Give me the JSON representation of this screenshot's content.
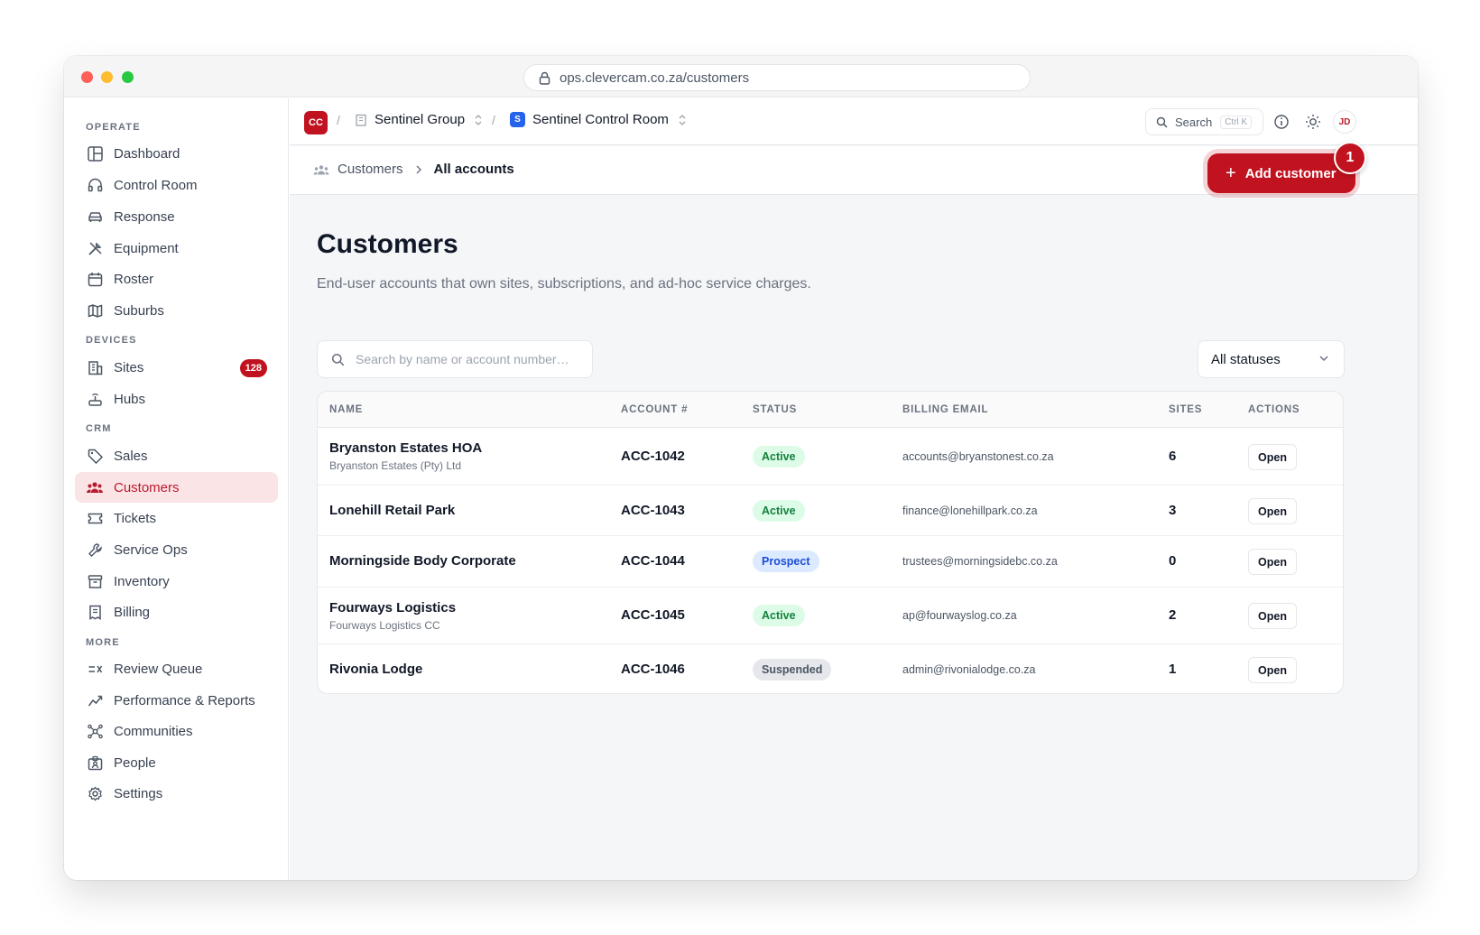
{
  "browser": {
    "url": "ops.clevercam.co.za/customers"
  },
  "sidebar": {
    "sections": {
      "operate": "OPERATE",
      "devices": "DEVICES",
      "crm": "CRM",
      "more": "MORE"
    },
    "operate_items": [
      {
        "label": "Dashboard",
        "icon": "layout-icon"
      },
      {
        "label": "Control Room",
        "icon": "headset-icon"
      },
      {
        "label": "Response",
        "icon": "car-icon"
      },
      {
        "label": "Equipment",
        "icon": "tools-icon"
      },
      {
        "label": "Roster",
        "icon": "calendar-icon"
      },
      {
        "label": "Suburbs",
        "icon": "map-icon"
      }
    ],
    "devices_items": [
      {
        "label": "Sites",
        "icon": "building-icon",
        "badge": "128"
      },
      {
        "label": "Hubs",
        "icon": "router-icon"
      }
    ],
    "crm_items": [
      {
        "label": "Sales",
        "icon": "tag-icon"
      },
      {
        "label": "Customers",
        "icon": "users-icon",
        "active": true
      },
      {
        "label": "Tickets",
        "icon": "ticket-icon"
      },
      {
        "label": "Service Ops",
        "icon": "wrench-icon"
      },
      {
        "label": "Inventory",
        "icon": "archive-icon"
      },
      {
        "label": "Billing",
        "icon": "receipt-icon"
      }
    ],
    "more_items": [
      {
        "label": "Review Queue",
        "icon": "list-x-icon"
      },
      {
        "label": "Performance & Reports",
        "icon": "chart-line-icon"
      },
      {
        "label": "Communities",
        "icon": "network-icon"
      },
      {
        "label": "People",
        "icon": "id-badge-icon"
      },
      {
        "label": "Settings",
        "icon": "gear-icon"
      }
    ]
  },
  "topbar": {
    "logo": "CC",
    "org": "Sentinel Group",
    "room_logo": "S",
    "room": "Sentinel Control Room",
    "search_label": "Search",
    "search_shortcut": "Ctrl K",
    "avatar": "JD"
  },
  "breadcrumb": {
    "parent": "Customers",
    "current": "All accounts"
  },
  "actions": {
    "add_label": "Add customer",
    "marker": "1"
  },
  "page": {
    "title": "Customers",
    "subtitle": "End-user accounts that own sites, subscriptions, and ad-hoc service charges.",
    "search_placeholder": "Search by name or account number…",
    "status_filter": "All statuses"
  },
  "table": {
    "headers": {
      "name": "NAME",
      "account": "ACCOUNT #",
      "status": "STATUS",
      "email": "BILLING EMAIL",
      "sites": "SITES",
      "actions": "ACTIONS"
    },
    "rows": [
      {
        "name": "Bryanston Estates HOA",
        "legal": "Bryanston Estates (Pty) Ltd",
        "account": "ACC-1042",
        "status": "Active",
        "status_kind": "active",
        "email": "accounts@bryanstonest.co.za",
        "sites": "6",
        "action": "Open"
      },
      {
        "name": "Lonehill Retail Park",
        "legal": "",
        "account": "ACC-1043",
        "status": "Active",
        "status_kind": "active",
        "email": "finance@lonehillpark.co.za",
        "sites": "3",
        "action": "Open"
      },
      {
        "name": "Morningside Body Corporate",
        "legal": "",
        "account": "ACC-1044",
        "status": "Prospect",
        "status_kind": "prospect",
        "email": "trustees@morningsidebc.co.za",
        "sites": "0",
        "action": "Open"
      },
      {
        "name": "Fourways Logistics",
        "legal": "Fourways Logistics CC",
        "account": "ACC-1045",
        "status": "Active",
        "status_kind": "active",
        "email": "ap@fourwayslog.co.za",
        "sites": "2",
        "action": "Open"
      },
      {
        "name": "Rivonia Lodge",
        "legal": "",
        "account": "ACC-1046",
        "status": "Suspended",
        "status_kind": "suspended",
        "email": "admin@rivonialodge.co.za",
        "sites": "1",
        "action": "Open"
      }
    ]
  },
  "colors": {
    "brand": "#c1121f",
    "active_nav_bg": "#fbe4e6",
    "status_active": "#15803d",
    "status_prospect": "#1d4ed8",
    "status_suspended": "#4b5563"
  }
}
